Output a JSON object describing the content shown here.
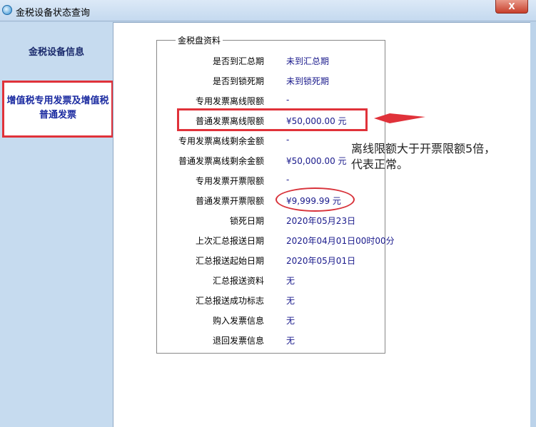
{
  "window": {
    "title": "金税设备状态查询",
    "close_label": "X"
  },
  "sidebar": {
    "items": [
      {
        "label": "金税设备信息"
      },
      {
        "label": "增值税专用发票及增值税普通发票"
      }
    ]
  },
  "panel": {
    "legend": "金税盘资料",
    "rows": [
      {
        "label": "是否到汇总期",
        "value": "未到汇总期"
      },
      {
        "label": "是否到锁死期",
        "value": "未到锁死期"
      },
      {
        "label": "专用发票离线限额",
        "value": "-"
      },
      {
        "label": "普通发票离线限额",
        "value": "¥50,000.00 元"
      },
      {
        "label": "专用发票离线剩余金额",
        "value": "-"
      },
      {
        "label": "普通发票离线剩余金额",
        "value": "¥50,000.00 元"
      },
      {
        "label": "专用发票开票限额",
        "value": "-"
      },
      {
        "label": "普通发票开票限额",
        "value": "¥9,999.99 元"
      },
      {
        "label": "锁死日期",
        "value": "2020年05月23日"
      },
      {
        "label": "上次汇总报送日期",
        "value": "2020年04月01日00时00分"
      },
      {
        "label": "汇总报送起始日期",
        "value": "2020年05月01日"
      },
      {
        "label": "汇总报送资料",
        "value": "无"
      },
      {
        "label": "汇总报送成功标志",
        "value": "无"
      },
      {
        "label": "购入发票信息",
        "value": "无"
      },
      {
        "label": "退回发票信息",
        "value": "无"
      }
    ]
  },
  "annotation": {
    "line1": "离线限额大于开票限额5倍，",
    "line2": "代表正常。",
    "color": "#e0323a"
  }
}
